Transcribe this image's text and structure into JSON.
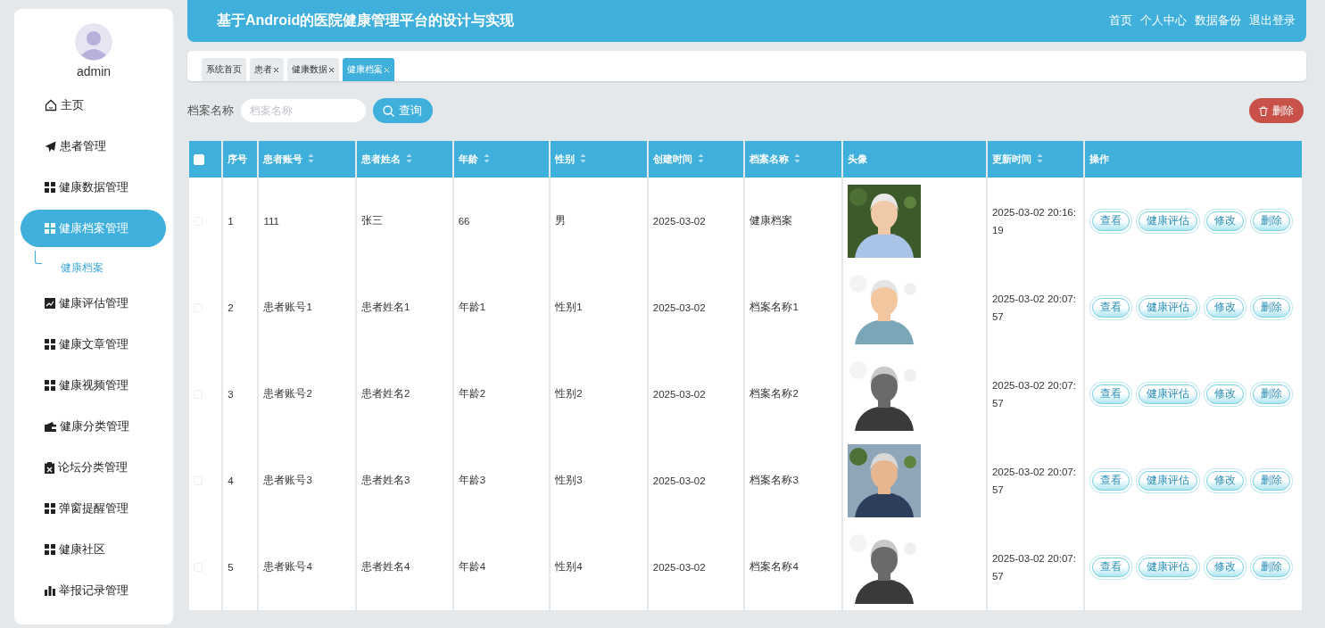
{
  "sidebar": {
    "user": {
      "name": "admin"
    },
    "menu": [
      {
        "label": "主页",
        "kind": "home",
        "selected": false
      },
      {
        "label": "患者管理",
        "kind": "send",
        "selected": false
      },
      {
        "label": "健康数据管理",
        "kind": "grid",
        "selected": false
      },
      {
        "label": "健康档案管理",
        "kind": "grid",
        "selected": true,
        "children": [
          {
            "label": "健康档案",
            "selected": true
          }
        ]
      },
      {
        "label": "健康评估管理",
        "kind": "chart",
        "selected": false
      },
      {
        "label": "健康文章管理",
        "kind": "grid",
        "selected": false
      },
      {
        "label": "健康视频管理",
        "kind": "grid",
        "selected": false
      },
      {
        "label": "健康分类管理",
        "kind": "wallet",
        "selected": false
      },
      {
        "label": "论坛分类管理",
        "kind": "clipboard",
        "selected": false
      },
      {
        "label": "弹窗提醒管理",
        "kind": "grid",
        "selected": false
      },
      {
        "label": "健康社区",
        "kind": "grid",
        "selected": false
      },
      {
        "label": "举报记录管理",
        "kind": "bars",
        "selected": false
      }
    ]
  },
  "header": {
    "title": "基于Android的医院健康管理平台的设计与实现",
    "links": [
      "首页",
      "个人中心",
      "数据备份",
      "退出登录"
    ]
  },
  "tabs": [
    {
      "label": "系统首页",
      "selected": false,
      "closable": false
    },
    {
      "label": "患者",
      "selected": false,
      "closable": true
    },
    {
      "label": "健康数据",
      "selected": false,
      "closable": true
    },
    {
      "label": "健康档案",
      "selected": true,
      "closable": true
    }
  ],
  "search": {
    "label": "档案名称",
    "placeholder": "档案名称",
    "button": "查询"
  },
  "toolbar": {
    "delete_button": "删除"
  },
  "table": {
    "columns": [
      {
        "kind": "checkbox",
        "checked": false
      },
      {
        "kind": "text",
        "label": "序号",
        "sortable": false
      },
      {
        "kind": "text",
        "label": "患者账号",
        "sortable": true
      },
      {
        "kind": "text",
        "label": "患者姓名",
        "sortable": true
      },
      {
        "kind": "text",
        "label": "年龄",
        "sortable": true
      },
      {
        "kind": "text",
        "label": "性别",
        "sortable": true
      },
      {
        "kind": "text",
        "label": "创建时间",
        "sortable": true
      },
      {
        "kind": "text",
        "label": "档案名称",
        "sortable": true
      },
      {
        "kind": "text",
        "label": "头像",
        "sortable": false
      },
      {
        "kind": "text",
        "label": "更新时间",
        "sortable": true
      },
      {
        "kind": "text",
        "label": "操作",
        "sortable": false
      }
    ],
    "rows": [
      {
        "checked": false,
        "seq": "1",
        "account": "111",
        "name": "张三",
        "age": "66",
        "gender": "男",
        "created": "2025-03-02",
        "archive": "健康档案",
        "avatar": {
          "kind": "picture"
        },
        "updated": "2025-03-02 20:16:19",
        "actions": [
          "查看",
          "健康评估",
          "修改",
          "删除"
        ]
      },
      {
        "checked": false,
        "seq": "2",
        "account": "患者账号1",
        "name": "患者姓名1",
        "age": "年龄1",
        "gender": "性别1",
        "created": "2025-03-02",
        "archive": "档案名称1",
        "avatar": {
          "kind": "picture"
        },
        "updated": "2025-03-02 20:07:57",
        "actions": [
          "查看",
          "健康评估",
          "修改",
          "删除"
        ]
      },
      {
        "checked": false,
        "seq": "3",
        "account": "患者账号2",
        "name": "患者姓名2",
        "age": "年龄2",
        "gender": "性别2",
        "created": "2025-03-02",
        "archive": "档案名称2",
        "avatar": {
          "kind": "picture"
        },
        "updated": "2025-03-02 20:07:57",
        "actions": [
          "查看",
          "健康评估",
          "修改",
          "删除"
        ]
      },
      {
        "checked": false,
        "seq": "4",
        "account": "患者账号3",
        "name": "患者姓名3",
        "age": "年龄3",
        "gender": "性别3",
        "created": "2025-03-02",
        "archive": "档案名称3",
        "avatar": {
          "kind": "picture"
        },
        "updated": "2025-03-02 20:07:57",
        "actions": [
          "查看",
          "健康评估",
          "修改",
          "删除"
        ]
      },
      {
        "checked": false,
        "seq": "5",
        "account": "患者账号4",
        "name": "患者姓名4",
        "age": "年龄4",
        "gender": "性别4",
        "created": "2025-03-02",
        "archive": "档案名称4",
        "avatar": {
          "kind": "picture"
        },
        "updated": "2025-03-02 20:07:57",
        "actions": [
          "查看",
          "健康评估",
          "修改",
          "删除"
        ]
      }
    ]
  }
}
